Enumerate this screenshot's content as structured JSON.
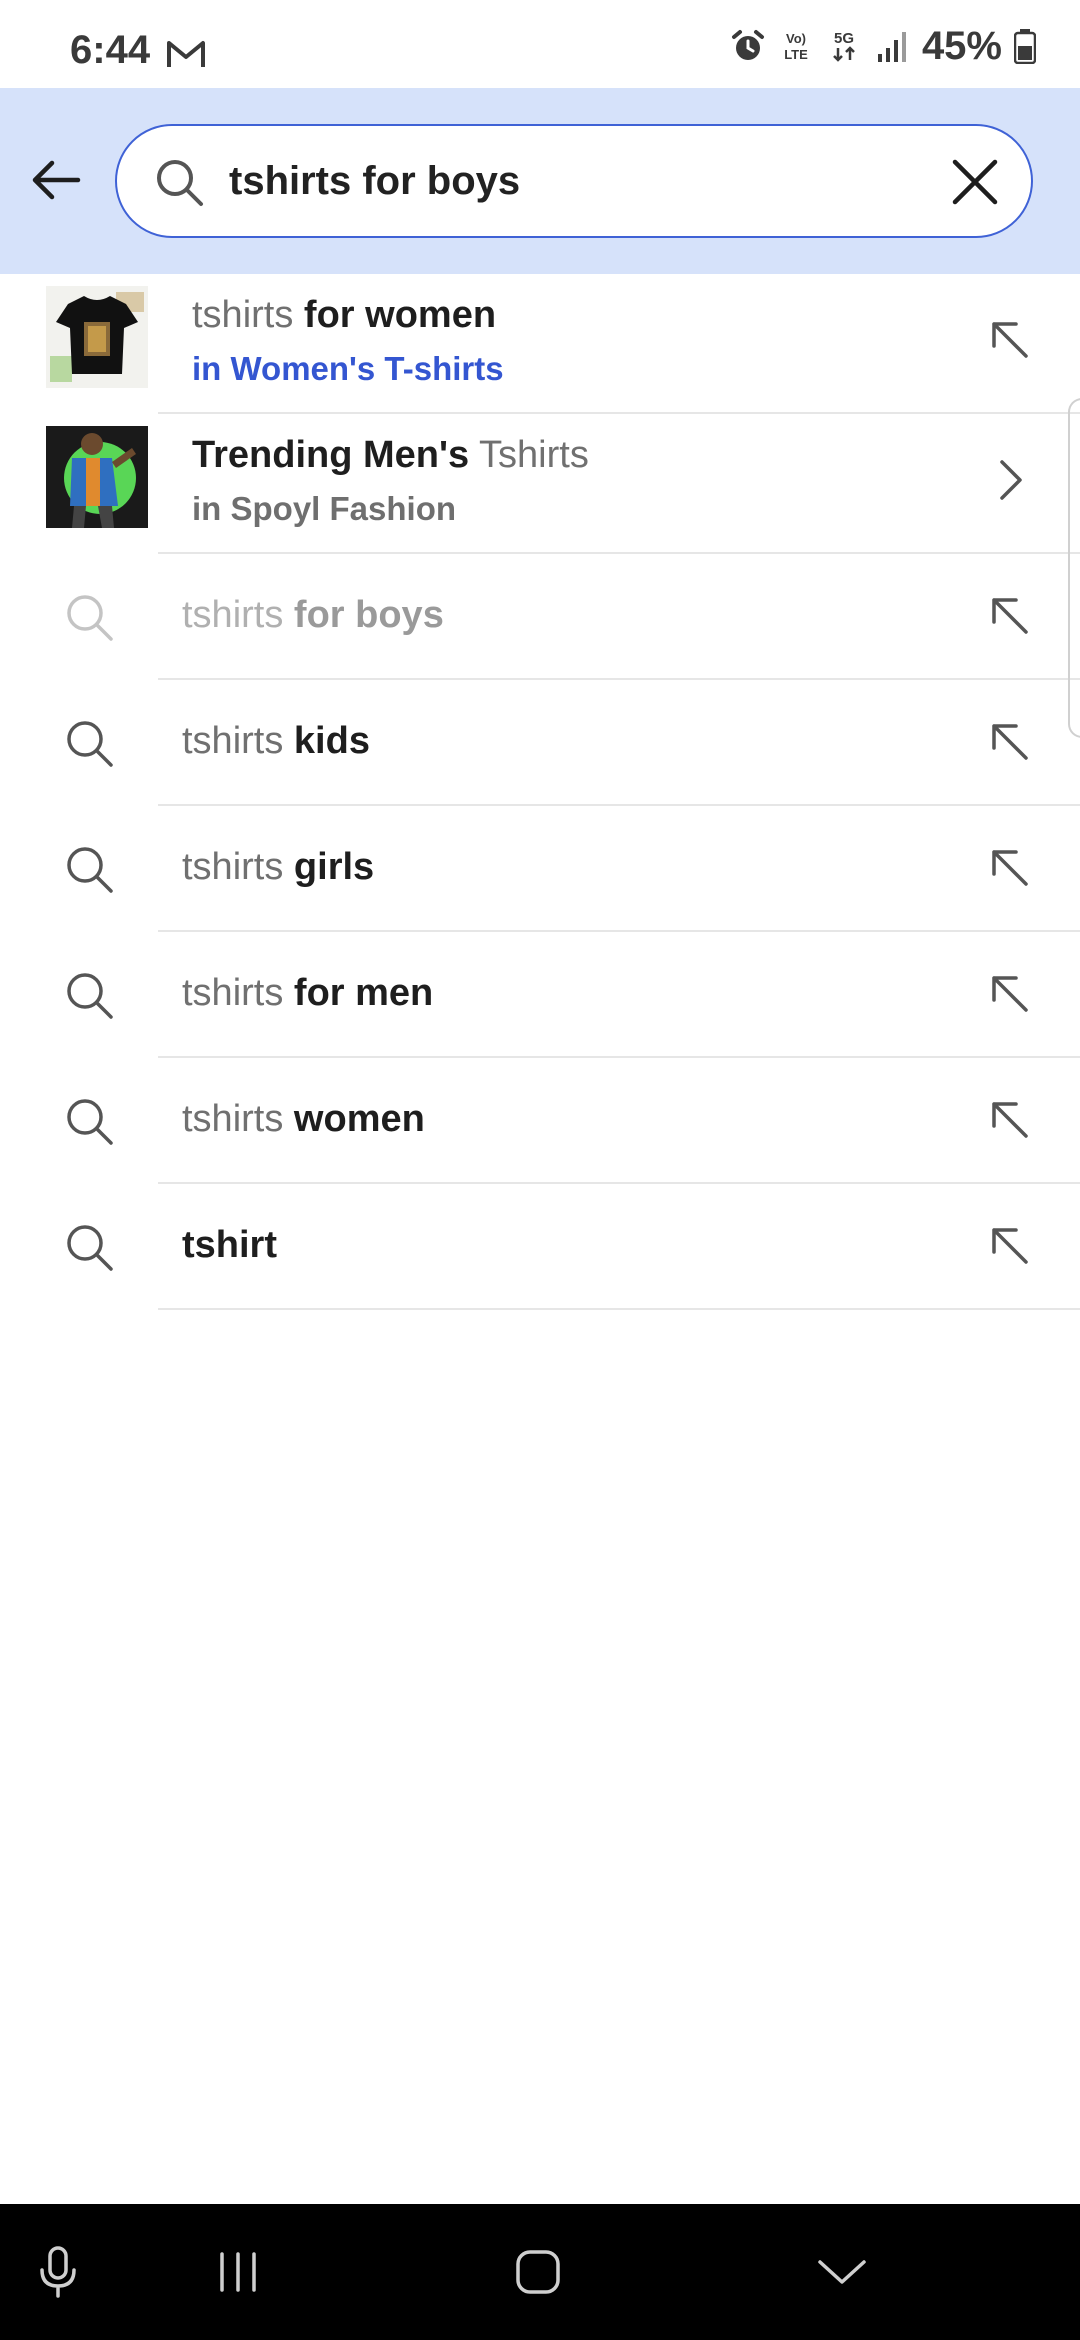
{
  "status_bar": {
    "time": "6:44",
    "battery": "45%"
  },
  "search": {
    "query": "tshirts for boys"
  },
  "category_suggestions": [
    {
      "prefix": "tshirts",
      "main": "for women",
      "main_first": false,
      "subtitle": "in Women's T-shirts",
      "subtitle_color": "#3456d1",
      "trail_icon": "arrow-up-left-icon"
    },
    {
      "prefix": "Tshirts",
      "main": "Trending Men's",
      "main_first": true,
      "subtitle": "in Spoyl Fashion",
      "subtitle_color": "#6f6f6f",
      "trail_icon": "chevron-right-icon"
    }
  ],
  "query_suggestions": [
    {
      "prefix": "tshirts",
      "rest": "for boys",
      "faded": true
    },
    {
      "prefix": "tshirts",
      "rest": "kids"
    },
    {
      "prefix": "tshirts",
      "rest": "girls"
    },
    {
      "prefix": "tshirts",
      "rest": "for men"
    },
    {
      "prefix": "tshirts",
      "rest": "women"
    },
    {
      "prefix": "",
      "rest": "tshirt"
    }
  ],
  "colors": {
    "header_bg": "#d6e2fa",
    "accent": "#3f62d6",
    "link_blue": "#3456d1"
  }
}
